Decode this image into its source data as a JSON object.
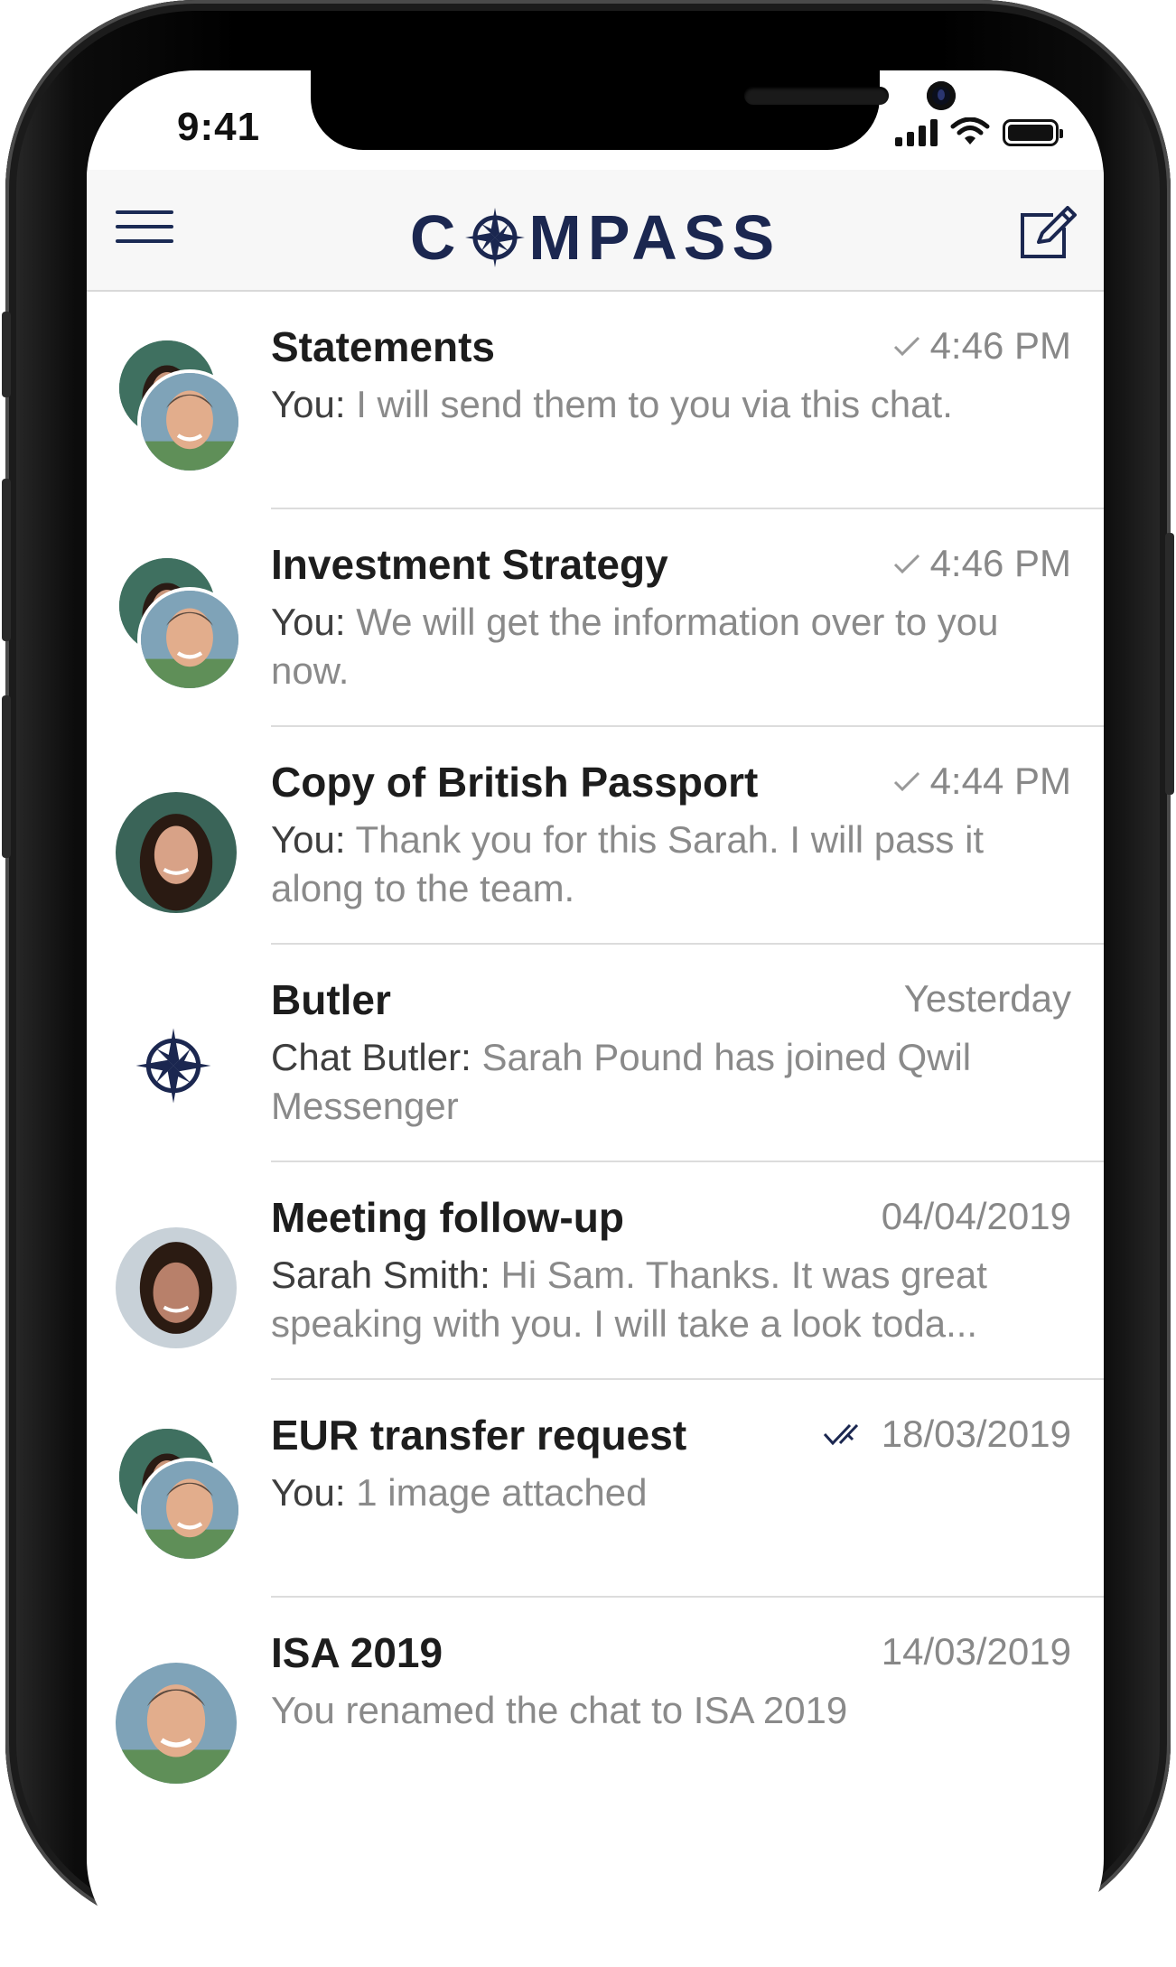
{
  "status_bar": {
    "time": "9:41"
  },
  "header": {
    "logo_pre": "C",
    "logo_post": "MPASS"
  },
  "colors": {
    "brand_navy": "#1b2750",
    "muted_text": "#8a8a8a",
    "divider": "#dcdcdc"
  },
  "chats": [
    {
      "title": "Statements",
      "time": "4:46 PM",
      "status": "sent",
      "sender": "You:",
      "message": "I will send them to you via this chat.",
      "avatar": "group-avatar"
    },
    {
      "title": "Investment Strategy",
      "time": "4:46 PM",
      "status": "sent",
      "sender": "You:",
      "message": "We will get the information over to you now.",
      "avatar": "group-avatar"
    },
    {
      "title": "Copy of British Passport",
      "time": "4:44 PM",
      "status": "sent",
      "sender": "You:",
      "message": "Thank you for this Sarah. I will pass it along to the team.",
      "avatar": "woman-avatar"
    },
    {
      "title": "Butler",
      "time": "Yesterday",
      "status": "none",
      "sender": "Chat Butler:",
      "message": "Sarah Pound has joined Qwil Messenger",
      "avatar": "compass-icon"
    },
    {
      "title": "Meeting follow-up",
      "time": "04/04/2019",
      "status": "none",
      "sender": "Sarah Smith:",
      "message": "Hi Sam. Thanks. It was great speaking with you. I will take a look toda...",
      "avatar": "woman-avatar"
    },
    {
      "title": "EUR transfer request",
      "time": "18/03/2019",
      "status": "read",
      "sender": "You:",
      "message": "1 image attached",
      "avatar": "group-avatar"
    },
    {
      "title": "ISA 2019",
      "time": "14/03/2019",
      "status": "none",
      "sender": "",
      "message": "You renamed the chat to ISA 2019",
      "avatar": "man-avatar"
    }
  ]
}
